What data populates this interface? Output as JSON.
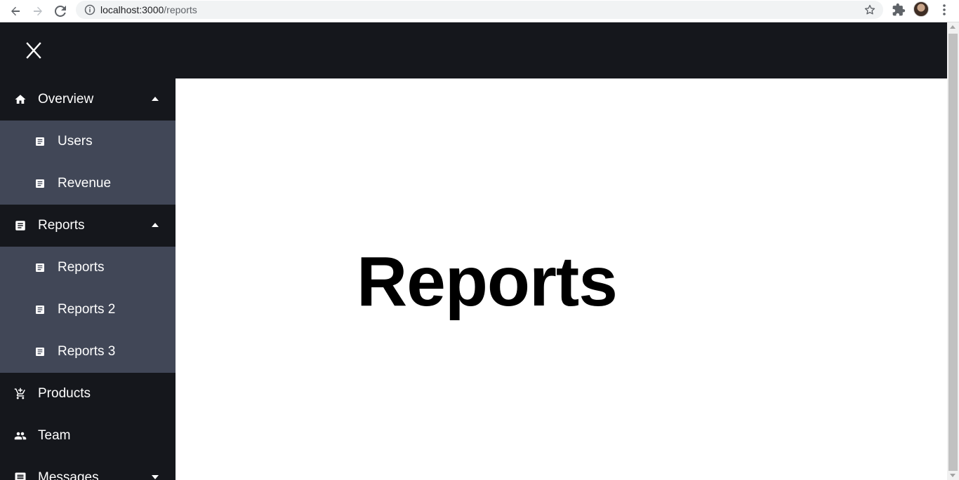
{
  "browser": {
    "url_host": "localhost:3000",
    "url_path": "/reports"
  },
  "sidebar": {
    "items": [
      {
        "label": "Overview",
        "icon": "home-icon",
        "level": "top",
        "caret": "up"
      },
      {
        "label": "Users",
        "icon": "document-icon",
        "level": "sub"
      },
      {
        "label": "Revenue",
        "icon": "document-icon",
        "level": "sub"
      },
      {
        "label": "Reports",
        "icon": "document-icon",
        "level": "top",
        "caret": "up"
      },
      {
        "label": "Reports",
        "icon": "document-icon",
        "level": "sub"
      },
      {
        "label": "Reports 2",
        "icon": "document-icon",
        "level": "sub"
      },
      {
        "label": "Reports 3",
        "icon": "document-icon",
        "level": "sub"
      },
      {
        "label": "Products",
        "icon": "cart-icon",
        "level": "top"
      },
      {
        "label": "Team",
        "icon": "team-icon",
        "level": "top"
      },
      {
        "label": "Messages",
        "icon": "message-icon",
        "level": "top",
        "caret": "down"
      }
    ]
  },
  "main": {
    "title": "Reports"
  },
  "colors": {
    "sidebar_bg": "#15171c",
    "submenu_bg": "#414757",
    "text": "#ffffff"
  }
}
